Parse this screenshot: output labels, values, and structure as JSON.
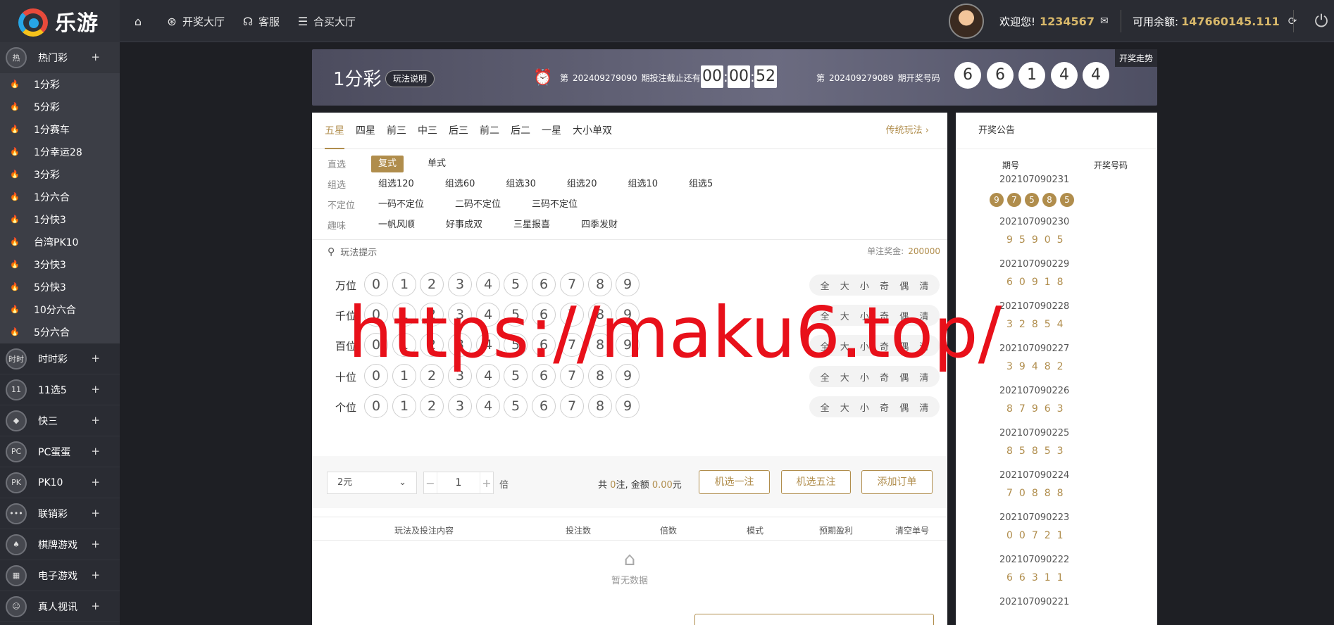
{
  "logo": {
    "text": "乐游"
  },
  "topnav": {
    "draw_hall": "开奖大厅",
    "service": "客服",
    "hemai": "合买大厅"
  },
  "user": {
    "welcome": "欢迎您!",
    "uid": "1234567",
    "balance_label": "可用余额:",
    "balance": "147660145.111"
  },
  "sidebar": {
    "hot": {
      "label": "热门彩",
      "icon": "热"
    },
    "hot_items": [
      "1分彩",
      "5分彩",
      "1分赛车",
      "1分幸运28",
      "3分彩",
      "1分六合",
      "1分快3",
      "台湾PK10",
      "3分快3",
      "5分快3",
      "10分六合",
      "5分六合"
    ],
    "cats": [
      {
        "label": "时时彩",
        "icon": "时时"
      },
      {
        "label": "11选5",
        "icon": "11"
      },
      {
        "label": "快三",
        "icon": "◆"
      },
      {
        "label": "PC蛋蛋",
        "icon": "PC"
      },
      {
        "label": "PK10",
        "icon": "PK"
      },
      {
        "label": "联销彩",
        "icon": "•••"
      },
      {
        "label": "棋牌游戏",
        "icon": "♠"
      },
      {
        "label": "电子游戏",
        "icon": "▦"
      },
      {
        "label": "真人视讯",
        "icon": "☺"
      }
    ],
    "plus": "+"
  },
  "banner": {
    "game_name": "1分彩",
    "rules": "玩法说明",
    "issue_prefix": "第",
    "cur_issue": "202409279090",
    "cur_suffix": "期投注截止还有",
    "countdown": [
      "00",
      "00",
      "52"
    ],
    "last_issue": "202409279089",
    "last_suffix": "期开奖号码",
    "last_numbers": [
      "6",
      "6",
      "1",
      "4",
      "4"
    ],
    "trend": "开奖走势"
  },
  "tabs": {
    "items": [
      "五星",
      "四星",
      "前三",
      "中三",
      "后三",
      "前二",
      "后二",
      "一星",
      "大小单双"
    ],
    "traditional": "传统玩法"
  },
  "subopts": [
    {
      "label": "直选",
      "opts": [
        "复式",
        "单式"
      ]
    },
    {
      "label": "组选",
      "opts": [
        "组选120",
        "组选60",
        "组选30",
        "组选20",
        "组选10",
        "组选5"
      ]
    },
    {
      "label": "不定位",
      "opts": [
        "一码不定位",
        "二码不定位",
        "三码不定位"
      ]
    },
    {
      "label": "趣味",
      "opts": [
        "一帆风顺",
        "好事成双",
        "三星报喜",
        "四季发财"
      ]
    }
  ],
  "hint": "玩法提示",
  "prize": {
    "label": "单注奖金:",
    "value": "200000"
  },
  "positions": [
    "万位",
    "千位",
    "百位",
    "十位",
    "个位"
  ],
  "digits": [
    "0",
    "1",
    "2",
    "3",
    "4",
    "5",
    "6",
    "7",
    "8",
    "9"
  ],
  "quick": [
    "全",
    "大",
    "小",
    "奇",
    "偶",
    "清"
  ],
  "betbar": {
    "unit": "2元",
    "multiple": "1",
    "times": "倍",
    "sum_a": "共",
    "count": "0",
    "sum_b": "注, 金额",
    "amount": "0.00",
    "sum_c": "元",
    "btn_random1": "机选一注",
    "btn_random5": "机选五注",
    "btn_add": "添加订单"
  },
  "order_head": [
    "玩法及投注内容",
    "投注数",
    "倍数",
    "模式",
    "预期盈利",
    "清空单号"
  ],
  "empty": "暂无数据",
  "results": {
    "title": "开奖公告",
    "col_issue": "期号",
    "col_numbers": "开奖号码",
    "rows": [
      {
        "issue": "202107090231",
        "nums": [
          "9",
          "7",
          "5",
          "8",
          "5"
        ]
      },
      {
        "issue": "202107090230",
        "nums": "95905"
      },
      {
        "issue": "202107090229",
        "nums": "60918"
      },
      {
        "issue": "202107090228",
        "nums": "32854"
      },
      {
        "issue": "202107090227",
        "nums": "39482"
      },
      {
        "issue": "202107090226",
        "nums": "87963"
      },
      {
        "issue": "202107090225",
        "nums": "85853"
      },
      {
        "issue": "202107090224",
        "nums": "70888"
      },
      {
        "issue": "202107090223",
        "nums": "00721"
      },
      {
        "issue": "202107090222",
        "nums": "66311"
      },
      {
        "issue": "202107090221",
        "nums": ""
      }
    ]
  },
  "watermark": "https://maku6.top/"
}
